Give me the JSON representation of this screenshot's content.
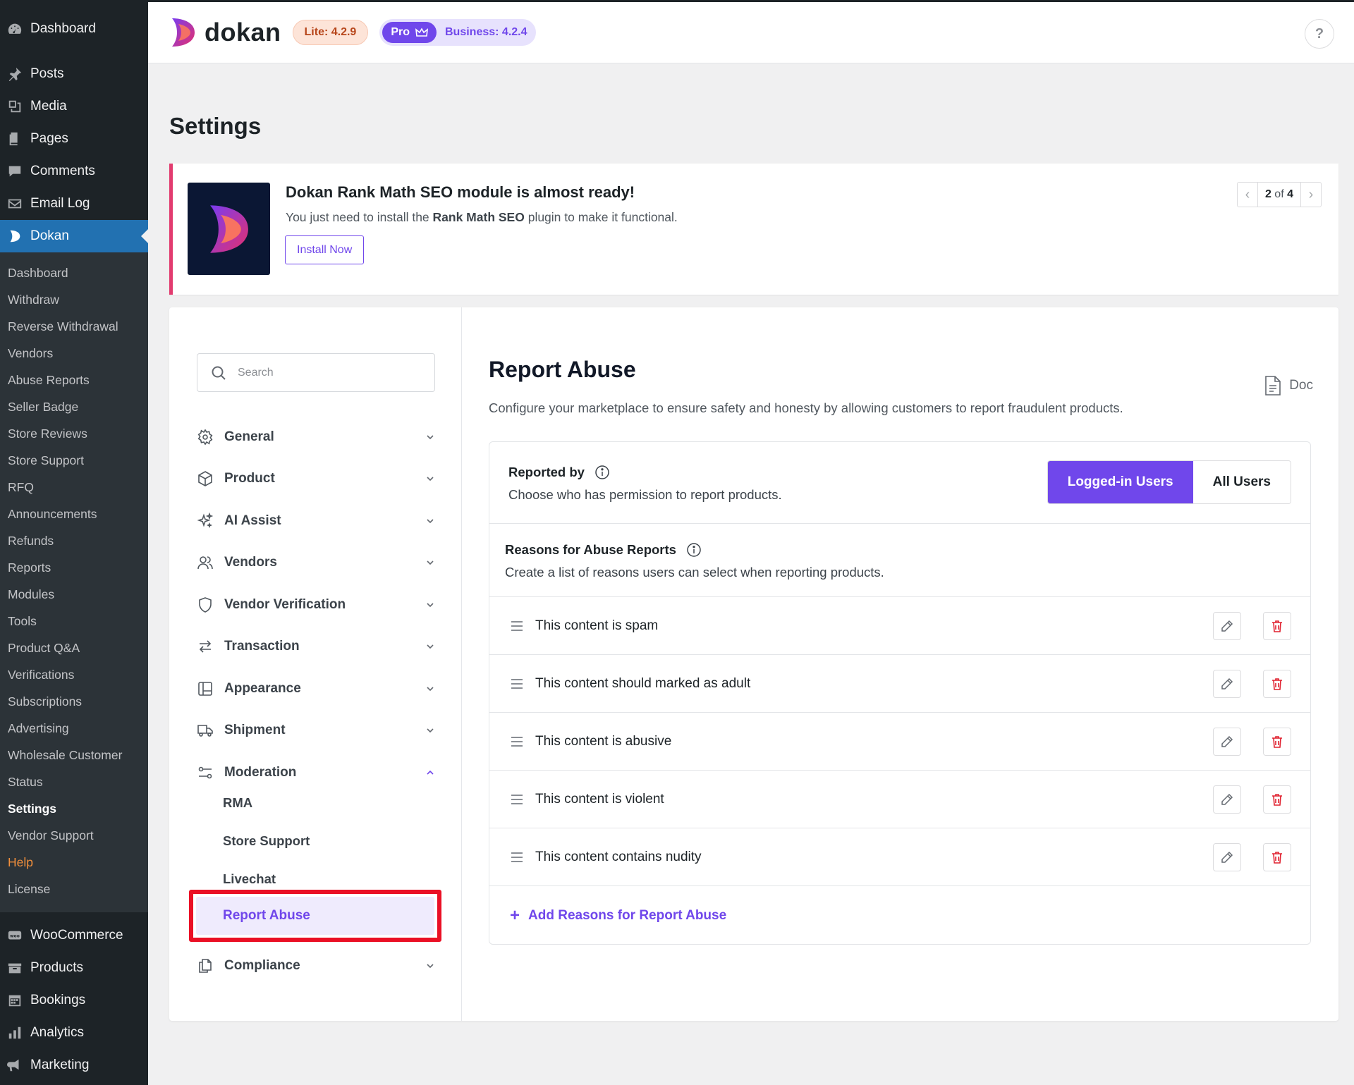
{
  "wp_menu": {
    "top_items": [
      {
        "label": "Dashboard",
        "icon": "dashboard-icon"
      },
      {
        "label": "Posts",
        "icon": "pin-icon"
      },
      {
        "label": "Media",
        "icon": "media-icon"
      },
      {
        "label": "Pages",
        "icon": "pages-icon"
      },
      {
        "label": "Comments",
        "icon": "comments-icon"
      },
      {
        "label": "Email Log",
        "icon": "email-icon"
      },
      {
        "label": "Dokan",
        "icon": "dokan-icon"
      }
    ],
    "dokan_submenu": [
      "Dashboard",
      "Withdraw",
      "Reverse Withdrawal",
      "Vendors",
      "Abuse Reports",
      "Seller Badge",
      "Store Reviews",
      "Store Support",
      "RFQ",
      "Announcements",
      "Refunds",
      "Reports",
      "Modules",
      "Tools",
      "Product Q&A",
      "Verifications",
      "Subscriptions",
      "Advertising",
      "Wholesale Customer",
      "Status",
      "Settings",
      "Vendor Support",
      "Help",
      "License"
    ],
    "bottom_items": [
      {
        "label": "WooCommerce",
        "icon": "woocommerce-icon"
      },
      {
        "label": "Products",
        "icon": "products-icon"
      },
      {
        "label": "Bookings",
        "icon": "calendar-icon"
      },
      {
        "label": "Analytics",
        "icon": "analytics-icon"
      },
      {
        "label": "Marketing",
        "icon": "megaphone-icon"
      }
    ]
  },
  "header": {
    "logo_text": "dokan",
    "lite_badge": "Lite: 4.2.9",
    "pro_badge": "Pro",
    "business_badge": "Business: 4.2.4",
    "help_label": "?"
  },
  "page": {
    "title": "Settings"
  },
  "notice": {
    "title": "Dokan Rank Math SEO module is almost ready!",
    "desc_before": "You just need to install the ",
    "desc_bold": "Rank Math SEO",
    "desc_after": " plugin to make it functional.",
    "install_label": "Install Now",
    "pager_current": "2",
    "pager_sep": "of",
    "pager_total": "4"
  },
  "settings_nav": {
    "search_placeholder": "Search",
    "items": [
      {
        "label": "General",
        "icon": "gear-icon"
      },
      {
        "label": "Product",
        "icon": "cube-icon"
      },
      {
        "label": "AI Assist",
        "icon": "sparkles-icon"
      },
      {
        "label": "Vendors",
        "icon": "users-icon"
      },
      {
        "label": "Vendor Verification",
        "icon": "shield-icon"
      },
      {
        "label": "Transaction",
        "icon": "arrows-swap-icon"
      },
      {
        "label": "Appearance",
        "icon": "layout-icon"
      },
      {
        "label": "Shipment",
        "icon": "truck-icon"
      },
      {
        "label": "Moderation",
        "icon": "sliders-icon"
      }
    ],
    "moderation_sub": [
      "RMA",
      "Store Support",
      "Livechat",
      "Report Abuse"
    ],
    "last_item": {
      "label": "Compliance",
      "icon": "copy-icon"
    }
  },
  "content": {
    "title": "Report Abuse",
    "doc_label": "Doc",
    "description": "Configure your marketplace to ensure safety and honesty by allowing customers to report fraudulent products.",
    "reported_by": {
      "title": "Reported by",
      "desc": "Choose who has permission to report products.",
      "options": [
        "Logged-in Users",
        "All Users"
      ],
      "selected": "Logged-in Users"
    },
    "reasons": {
      "title": "Reasons for Abuse Reports",
      "desc": "Create a list of reasons users can select when reporting products.",
      "items": [
        "This content is spam",
        "This content should marked as adult",
        "This content is abusive",
        "This content is violent",
        "This content contains nudity"
      ],
      "add_label": "Add Reasons for Report Abuse"
    }
  },
  "colors": {
    "wp_sidebar": "#1d2327",
    "wp_active": "#2271b1",
    "accent": "#7047eb",
    "danger": "#e0212f",
    "highlight": "#ea1025",
    "notice_border": "#e23b6f"
  }
}
